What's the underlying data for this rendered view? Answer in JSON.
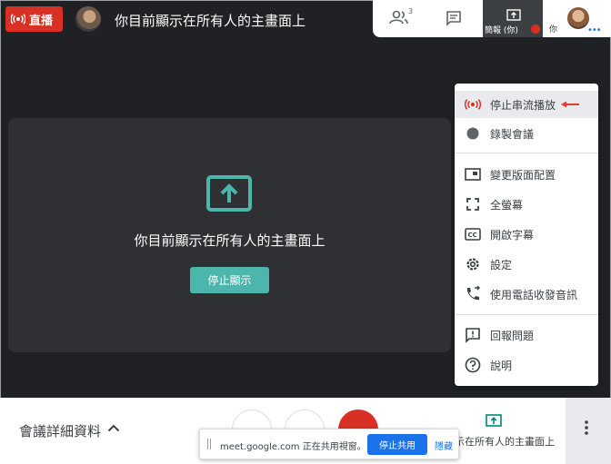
{
  "top_bar": {
    "live_label": "直播",
    "title": "你目前顯示在所有人的主畫面上",
    "people_count": "3",
    "presenter_tile_label": "簡報 (你)",
    "self_tile_label": "你"
  },
  "present_card": {
    "message": "你目前顯示在所有人的主畫面上",
    "stop_button": "停止顯示"
  },
  "menu": {
    "items": [
      {
        "label": "停止串流播放",
        "icon": "live-icon"
      },
      {
        "label": "錄製會議",
        "icon": "record-icon"
      },
      {
        "label": "變更版面配置",
        "icon": "layout-icon"
      },
      {
        "label": "全螢幕",
        "icon": "fullscreen-icon"
      },
      {
        "label": "開啟字幕",
        "icon": "captions-icon"
      },
      {
        "label": "設定",
        "icon": "gear-icon"
      },
      {
        "label": "使用電話收發音訊",
        "icon": "phone-icon"
      },
      {
        "label": "回報問題",
        "icon": "feedback-icon"
      },
      {
        "label": "說明",
        "icon": "help-icon"
      }
    ]
  },
  "bottom_bar": {
    "details_label": "會議詳細資料",
    "present_label": "示在所有人的主畫面上"
  },
  "share_bar": {
    "message": "meet.google.com 正在共用視窗。",
    "stop_button": "停止共用",
    "hide_link": "隱藏"
  },
  "colors": {
    "live_red": "#d93025",
    "teal": "#4db6ac",
    "blue": "#1a73e8",
    "background": "#202124"
  }
}
